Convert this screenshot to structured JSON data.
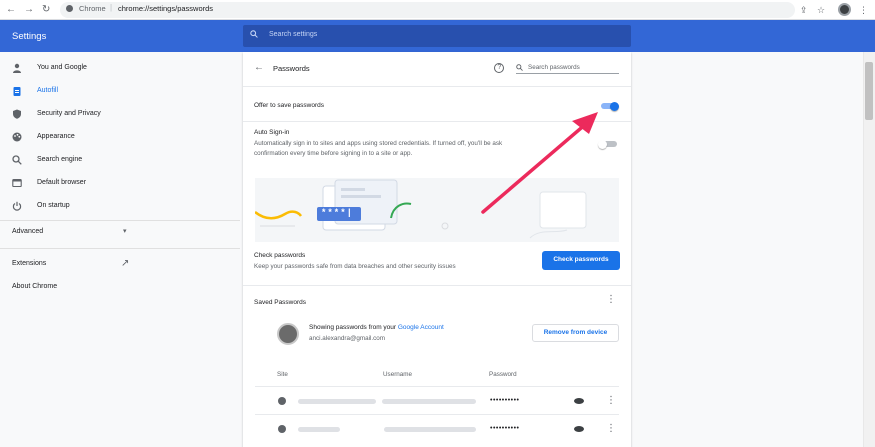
{
  "browser": {
    "back": "←",
    "forward": "→",
    "reload": "↻",
    "omnibox_scheme": "Chrome",
    "omnibox_sep": "|",
    "omnibox_url": "chrome://settings/passwords",
    "share": "⇪",
    "star": "☆",
    "menu": "⋮"
  },
  "header": {
    "title": "Settings",
    "search_placeholder": "Search settings"
  },
  "sidebar": {
    "items": [
      {
        "label": "You and Google",
        "icon": "person-icon"
      },
      {
        "label": "Autofill",
        "icon": "clipboard-icon",
        "active": true
      },
      {
        "label": "Security and Privacy",
        "icon": "shield-icon"
      },
      {
        "label": "Appearance",
        "icon": "palette-icon"
      },
      {
        "label": "Search engine",
        "icon": "search-icon"
      },
      {
        "label": "Default browser",
        "icon": "browser-icon"
      },
      {
        "label": "On startup",
        "icon": "power-icon"
      }
    ],
    "advanced": "Advanced",
    "advanced_chevron": "▾",
    "extensions": "Extensions",
    "extensions_icon": "↗",
    "about": "About Chrome"
  },
  "passwords": {
    "back_arrow": "←",
    "title": "Passwords",
    "help": "?",
    "search_placeholder": "Search passwords",
    "offer_to_save": {
      "label": "Offer to save passwords",
      "on": true
    },
    "auto_sign_in": {
      "label": "Auto Sign-in",
      "description_line1": "Automatically sign in to sites and apps using stored credentials. If turned off, you'll be ask",
      "description_line2": "confirmation every time before signing in to a site or app.",
      "on": false
    },
    "illustration_pw": "****|",
    "check": {
      "label": "Check passwords",
      "description": "Keep your passwords safe from data breaches and other security issues",
      "button": "Check passwords"
    },
    "saved": {
      "title": "Saved Passwords",
      "kebab": "⋮",
      "account_line_prefix": "Showing passwords from your ",
      "account_link": "Google Account",
      "email": "anci.alexandra@gmail.com",
      "remove_button": "Remove from device",
      "columns": [
        "Site",
        "Username",
        "Password"
      ],
      "rows": [
        {
          "password": "••••••••••",
          "eye": "eye-icon",
          "kebab": "⋮"
        },
        {
          "password": "••••••••••",
          "eye": "eye-icon",
          "kebab": "⋮"
        }
      ]
    }
  },
  "colors": {
    "header_blue": "#3367d6",
    "accent_blue": "#1a73e8",
    "annotation_arrow": "#ec2a5c"
  }
}
